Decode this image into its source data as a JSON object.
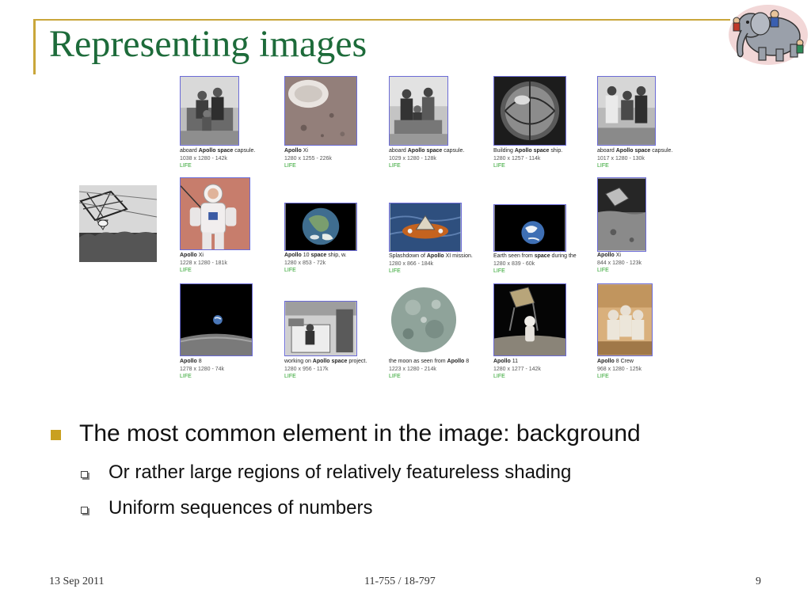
{
  "title": "Representing images",
  "bullets": {
    "main": "The most common element in the image: background",
    "sub": [
      "Or rather large regions of relatively featureless shading",
      "Uniform sequences of numbers"
    ]
  },
  "footer": {
    "date": "13 Sep 2011",
    "course": "11-755 / 18-797",
    "page": "9"
  },
  "results": [
    {
      "pre": "aboard ",
      "b1": "Apollo space",
      "post": " capsule.",
      "meta": "1038 x 1280 - 142k",
      "src": "LIFE"
    },
    {
      "pre": "",
      "b1": "Apollo",
      "post": " Xi",
      "meta": "1280 x 1255 - 226k",
      "src": "LIFE"
    },
    {
      "pre": "aboard ",
      "b1": "Apollo space",
      "post": " capsule.",
      "meta": "1029 x 1280 - 128k",
      "src": "LIFE"
    },
    {
      "pre": "Building ",
      "b1": "Apollo space",
      "post": " ship.",
      "meta": "1280 x 1257 - 114k",
      "src": "LIFE"
    },
    {
      "pre": "aboard ",
      "b1": "Apollo space",
      "post": " capsule.",
      "meta": "1017 x 1280 - 130k",
      "src": "LIFE"
    },
    {
      "pre": "",
      "b1": "Apollo",
      "post": " Xi",
      "meta": "1228 x 1280 - 181k",
      "src": "LIFE"
    },
    {
      "pre": "",
      "b1": "Apollo",
      "post": " 10 ",
      "b2": "space",
      "post2": " ship, w.",
      "meta": "1280 x 853 - 72k",
      "src": "LIFE"
    },
    {
      "pre": "Splashdown of ",
      "b1": "Apollo",
      "post": " XI mission.",
      "meta": "1280 x 866 - 184k",
      "src": "LIFE"
    },
    {
      "pre": "Earth seen from ",
      "b1": "space",
      "post": " during the",
      "meta": "1280 x 839 - 60k",
      "src": "LIFE"
    },
    {
      "pre": "",
      "b1": "Apollo",
      "post": " Xi",
      "meta": "844 x 1280 - 123k",
      "src": "LIFE"
    },
    {
      "pre": "",
      "b1": "Apollo",
      "post": " 8",
      "meta": "1278 x 1280 - 74k",
      "src": "LIFE"
    },
    {
      "pre": "working on ",
      "b1": "Apollo space",
      "post": " project.",
      "meta": "1280 x 956 - 117k",
      "src": "LIFE"
    },
    {
      "pre": "the moon as seen from ",
      "b1": "Apollo",
      "post": " 8",
      "meta": "1223 x 1280 - 214k",
      "src": "LIFE"
    },
    {
      "pre": "",
      "b1": "Apollo",
      "post": " 11",
      "meta": "1280 x 1277 - 142k",
      "src": "LIFE"
    },
    {
      "pre": "",
      "b1": "Apollo",
      "post": " 8 Crew",
      "meta": "968 x 1280 - 125k",
      "src": "LIFE"
    }
  ]
}
